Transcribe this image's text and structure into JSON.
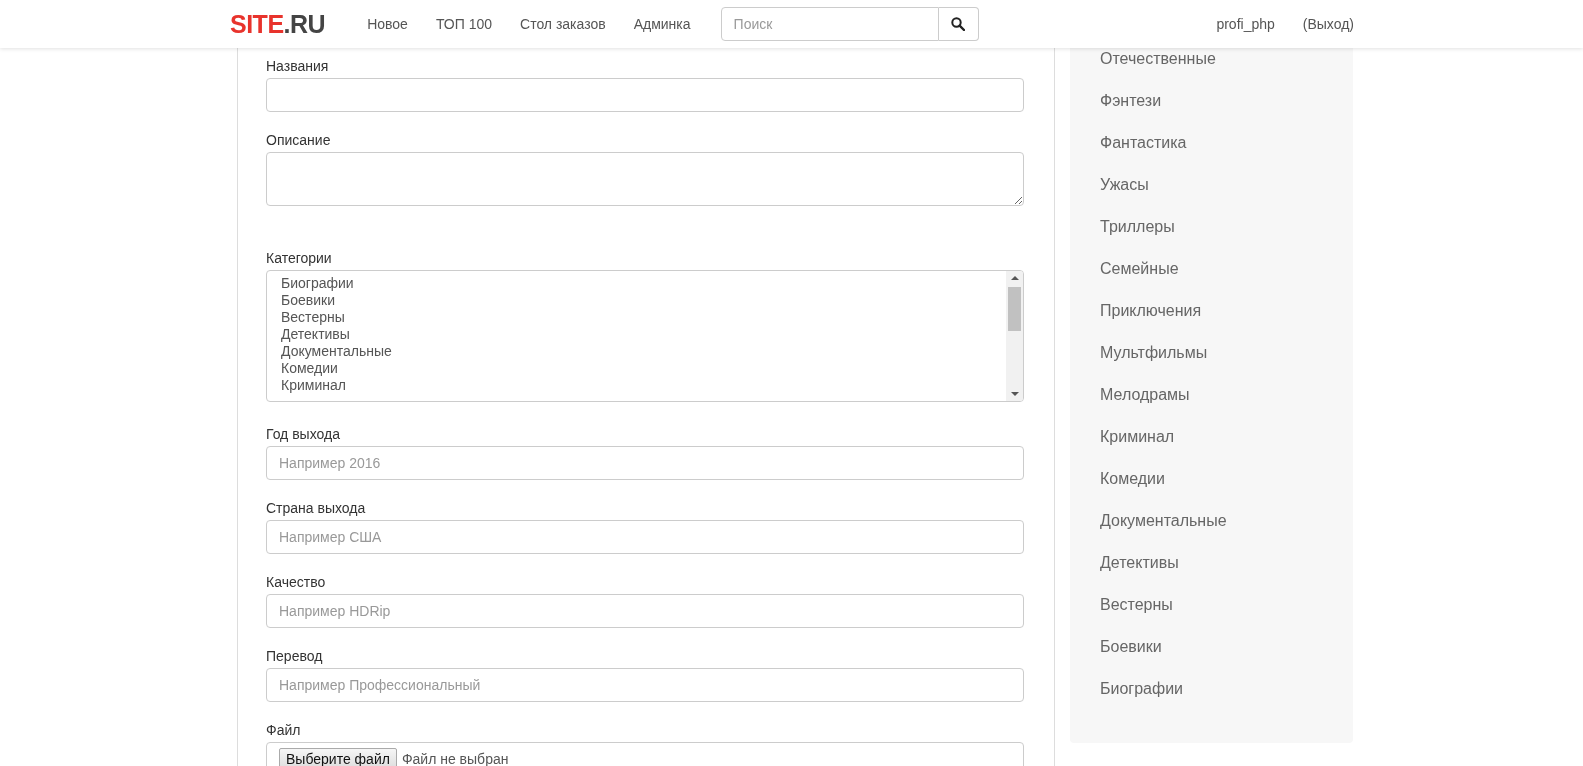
{
  "navbar": {
    "logo": {
      "accent": "SITE",
      "rest": ".RU"
    },
    "links": [
      "Новое",
      "ТОП 100",
      "Стол заказов",
      "Админка"
    ],
    "search": {
      "placeholder": "Поиск"
    },
    "user": "profi_php",
    "logout": "(Выход)"
  },
  "form": {
    "fields": [
      {
        "kind": "input",
        "label": "Названия"
      },
      {
        "kind": "textarea",
        "label": "Описание"
      },
      {
        "kind": "select",
        "label": "Категории",
        "options": [
          "Биографии",
          "Боевики",
          "Вестерны",
          "Детективы",
          "Документальные",
          "Комедии",
          "Криминал"
        ]
      },
      {
        "kind": "input",
        "label": "Год выхода",
        "placeholder": "Например 2016"
      },
      {
        "kind": "input",
        "label": "Страна выхода",
        "placeholder": "Например США"
      },
      {
        "kind": "input",
        "label": "Качество",
        "placeholder": "Например HDRip"
      },
      {
        "kind": "input",
        "label": "Перевод",
        "placeholder": "Например Профессиональный"
      },
      {
        "kind": "file",
        "label": "Файл",
        "button": "Выберите файл",
        "status": "Файл не выбран"
      }
    ]
  },
  "sidebar": {
    "items": [
      "Отечественные",
      "Фэнтези",
      "Фантастика",
      "Ужасы",
      "Триллеры",
      "Семейные",
      "Приключения",
      "Мультфильмы",
      "Мелодрамы",
      "Криминал",
      "Комедии",
      "Документальные",
      "Детективы",
      "Вестерны",
      "Боевики",
      "Биографии"
    ]
  }
}
